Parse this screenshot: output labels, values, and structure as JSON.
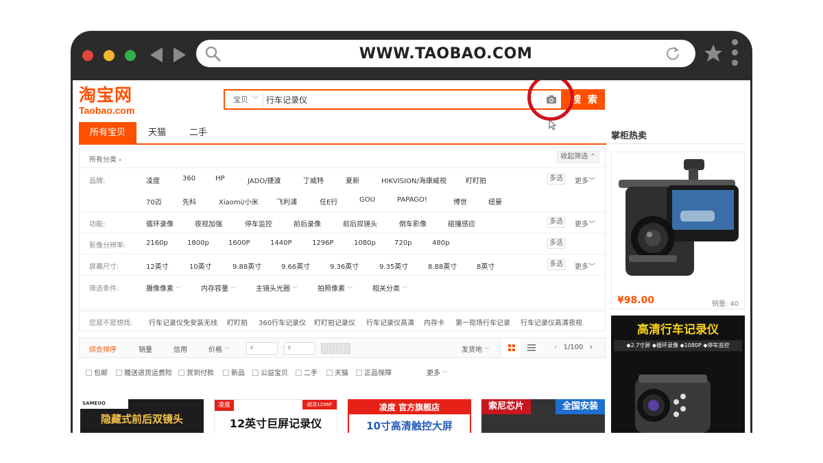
{
  "browser": {
    "url": "WWW.TAOBAO.COM"
  },
  "header": {
    "logo_cn": "淘宝网",
    "logo_en": "Taobao.com",
    "search_category": "宝贝",
    "search_query": "行车记录仪",
    "search_button": "搜 索"
  },
  "tabs": [
    "所有宝贝",
    "天猫",
    "二手"
  ],
  "sidebar": {
    "title": "掌柜热卖",
    "card1": {
      "price": "¥98.00",
      "sales": "销量: 40"
    },
    "card2": {
      "title": "高清行车记录仪",
      "tags": "◆2.7寸屏  ◆循环录像  ◆1080P  ◆停车监控"
    }
  },
  "filter": {
    "breadcrumb": "所有分类 ›",
    "collapse": "收起筛选 ⌃",
    "multi_label": "多选",
    "more_label": "更多",
    "brand": {
      "label": "品牌:",
      "row1": [
        "凌度",
        "360",
        "HP",
        "JADO/捷渡",
        "丁威特",
        "夏新",
        "HIKVISION/海康威视",
        "盯盯拍"
      ],
      "row2": [
        "70迈",
        "先科",
        "Xiaomi/小米",
        "飞利浦",
        "任E行",
        "GOU",
        "PAPAGO!",
        "博世",
        "纽曼"
      ]
    },
    "function": {
      "label": "功能:",
      "items": [
        "循环录像",
        "夜视加强",
        "停车监控",
        "前后录像",
        "前后双镜头",
        "倒车影像",
        "碰撞感应"
      ]
    },
    "resolution": {
      "label": "影像分辨率:",
      "items": [
        "2160p",
        "1800p",
        "1600P",
        "1440P",
        "1296P",
        "1080p",
        "720p",
        "480p"
      ]
    },
    "screen": {
      "label": "屏幕尺寸:",
      "items": [
        "12英寸",
        "10英寸",
        "9.88英寸",
        "9.66英寸",
        "9.36英寸",
        "9.35英寸",
        "8.88英寸",
        "8英寸"
      ]
    },
    "conditions": {
      "label": "筛选条件:",
      "items": [
        "摄像像素",
        "内存容量",
        "主镜头光圈",
        "拍照像素",
        "相关分类"
      ]
    }
  },
  "suggest": {
    "label": "您是不是想找:",
    "items": [
      "行车记录仪免安装无线",
      "盯盯拍",
      "360行车记录仪",
      "盯盯拍记录仪",
      "行车记录仪高清",
      "内存卡",
      "第一现场行车记录",
      "行车记录仪高清夜视"
    ]
  },
  "sortbar": {
    "items": [
      "综合排序",
      "销量",
      "信用",
      "价格"
    ],
    "price_from": "¥",
    "price_to": "¥",
    "dash": "-",
    "ship_from": "发货地",
    "pager": "1/100"
  },
  "checks": [
    "包邮",
    "赠送退货运费险",
    "货到付款",
    "新品",
    "公益宝贝",
    "二手",
    "天猫",
    "正品保障"
  ],
  "checks_more": "更多",
  "products": [
    {
      "banner": "隐藏式前后双镜头",
      "brand": "SAMEUO"
    },
    {
      "banner": "12英寸巨屏记录仪",
      "brand": "凌度",
      "badge": "超清1296P"
    },
    {
      "banner": "10寸高清触控大屏",
      "brand": "凌度 官方旗舰店"
    },
    {
      "banner": "索尼芯片",
      "badge": "全国安装"
    }
  ],
  "colors": {
    "accent": "#ff5000",
    "highlight_circle": "#d0121b"
  }
}
